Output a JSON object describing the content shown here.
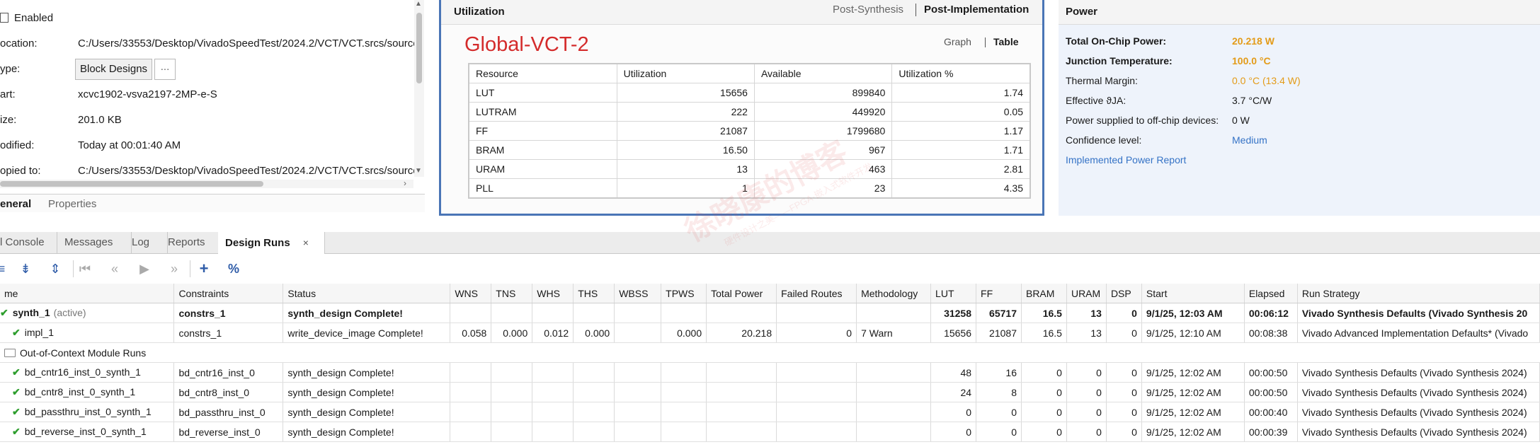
{
  "properties": {
    "enabled_label": "Enabled",
    "rows": [
      {
        "label": "ocation:",
        "value": "C:/Users/33553/Desktop/VivadoSpeedTest/2024.2/VCT/VCT.srcs/source"
      },
      {
        "label": "ype:",
        "value": "Block Designs"
      },
      {
        "label": "art:",
        "value": "xcvc1902-vsva2197-2MP-e-S"
      },
      {
        "label": "ize:",
        "value": "201.0 KB"
      },
      {
        "label": "odified:",
        "value": "Today at 00:01:40 AM"
      },
      {
        "label": "opied to:",
        "value": "C:/Users/33553/Desktop/VivadoSpeedTest/2024.2/VCT/VCT.srcs/source"
      }
    ],
    "more_button": "...",
    "tabs": [
      "eneral",
      "Properties"
    ]
  },
  "utilization": {
    "title": "Utilization",
    "mode_tabs": [
      "Post-Synthesis",
      "Post-Implementation"
    ],
    "design_name": "Global-VCT-2",
    "view_tabs": [
      "Graph",
      "Table"
    ],
    "columns": [
      "Resource",
      "Utilization",
      "Available",
      "Utilization %"
    ],
    "rows": [
      [
        "LUT",
        "15656",
        "899840",
        "1.74"
      ],
      [
        "LUTRAM",
        "222",
        "449920",
        "0.05"
      ],
      [
        "FF",
        "21087",
        "1799680",
        "1.17"
      ],
      [
        "BRAM",
        "16.50",
        "967",
        "1.71"
      ],
      [
        "URAM",
        "13",
        "463",
        "2.81"
      ],
      [
        "PLL",
        "1",
        "23",
        "4.35"
      ]
    ]
  },
  "power": {
    "title": "Power",
    "rows": [
      {
        "label": "Total On-Chip Power:",
        "value": "20.218 W"
      },
      {
        "label": "Junction Temperature:",
        "value": "100.0 °C"
      },
      {
        "label": "Thermal Margin:",
        "value": "0.0 °C (13.4 W)"
      },
      {
        "label": "Effective ϑJA:",
        "value": "3.7 °C/W"
      },
      {
        "label": "Power supplied to off-chip devices:",
        "value": "0 W"
      },
      {
        "label": "Confidence level:",
        "value": "Medium"
      }
    ],
    "report_link": "Implemented Power Report"
  },
  "bottom_tabs": [
    "l Console",
    "Messages",
    "Log",
    "Reports",
    "Design Runs"
  ],
  "bottom_tab_close": "×",
  "toolbar_icons": [
    "collapse-all-icon",
    "expand-all-icon",
    "expand-selection-icon",
    "first-icon",
    "previous-icon",
    "run-icon",
    "next-icon",
    "add-icon",
    "percent-icon"
  ],
  "runs": {
    "columns": [
      "me",
      "Constraints",
      "Status",
      "WNS",
      "TNS",
      "WHS",
      "THS",
      "WBSS",
      "TPWS",
      "Total Power",
      "Failed Routes",
      "Methodology",
      "LUT",
      "FF",
      "BRAM",
      "URAM",
      "DSP",
      "Start",
      "Elapsed",
      "Run Strategy"
    ],
    "active_note": "(active)",
    "section_label": "Out-of-Context Module Runs",
    "rows": [
      [
        "synth_1",
        "constrs_1",
        "synth_design Complete!",
        "",
        "",
        "",
        "",
        "",
        "",
        "",
        "",
        "",
        "31258",
        "65717",
        "16.5",
        "13",
        "0",
        "9/1/25, 12:03 AM",
        "00:06:12",
        "Vivado Synthesis Defaults (Vivado Synthesis 20"
      ],
      [
        "impl_1",
        "constrs_1",
        "write_device_image Complete!",
        "0.058",
        "0.000",
        "0.012",
        "0.000",
        "",
        "0.000",
        "20.218",
        "0",
        "7 Warn",
        "15656",
        "21087",
        "16.5",
        "13",
        "0",
        "9/1/25, 12:10 AM",
        "00:08:38",
        "Vivado Advanced Implementation Defaults* (Vivado"
      ],
      [
        "bd_cntr16_inst_0_synth_1",
        "bd_cntr16_inst_0",
        "synth_design Complete!",
        "",
        "",
        "",
        "",
        "",
        "",
        "",
        "",
        "",
        "48",
        "16",
        "0",
        "0",
        "0",
        "9/1/25, 12:02 AM",
        "00:00:50",
        "Vivado Synthesis Defaults (Vivado Synthesis 2024)"
      ],
      [
        "bd_cntr8_inst_0_synth_1",
        "bd_cntr8_inst_0",
        "synth_design Complete!",
        "",
        "",
        "",
        "",
        "",
        "",
        "",
        "",
        "",
        "24",
        "8",
        "0",
        "0",
        "0",
        "9/1/25, 12:02 AM",
        "00:00:50",
        "Vivado Synthesis Defaults (Vivado Synthesis 2024)"
      ],
      [
        "bd_passthru_inst_0_synth_1",
        "bd_passthru_inst_0",
        "synth_design Complete!",
        "",
        "",
        "",
        "",
        "",
        "",
        "",
        "",
        "",
        "0",
        "0",
        "0",
        "0",
        "0",
        "9/1/25, 12:02 AM",
        "00:00:40",
        "Vivado Synthesis Defaults (Vivado Synthesis 2024)"
      ],
      [
        "bd_reverse_inst_0_synth_1",
        "bd_reverse_inst_0",
        "synth_design Complete!",
        "",
        "",
        "",
        "",
        "",
        "",
        "",
        "",
        "",
        "0",
        "0",
        "0",
        "0",
        "0",
        "9/1/25, 12:02 AM",
        "00:00:39",
        "Vivado Synthesis Defaults (Vivado Synthesis 2024)"
      ]
    ]
  },
  "watermark": {
    "main": "徐晓康的博客",
    "sub": "硬件设计之美——FPGA·嵌入式软件开发"
  },
  "colors": {
    "accent_blue": "#4a75b6",
    "design_red": "#d42b2b",
    "power_orange": "#e39b18",
    "link_blue": "#3573c6",
    "ok_green": "#2e9e2e"
  }
}
